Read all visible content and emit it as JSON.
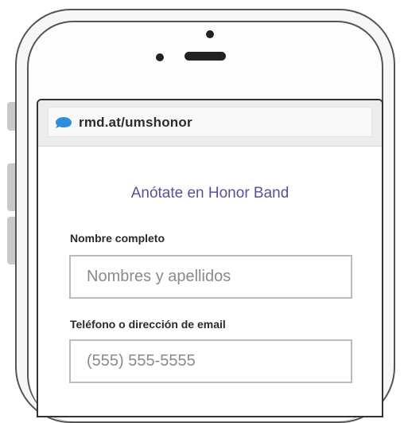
{
  "browser": {
    "url": "rmd.at/umshonor",
    "icon": "chat-bubble-icon",
    "icon_color": "#2f8fd8"
  },
  "form": {
    "title": "Anótate en Honor Band",
    "title_color": "#57509a",
    "fields": [
      {
        "label": "Nombre completo",
        "placeholder": "Nombres y apellidos"
      },
      {
        "label": "Teléfono o dirección de email",
        "placeholder": "(555) 555-5555"
      }
    ]
  }
}
